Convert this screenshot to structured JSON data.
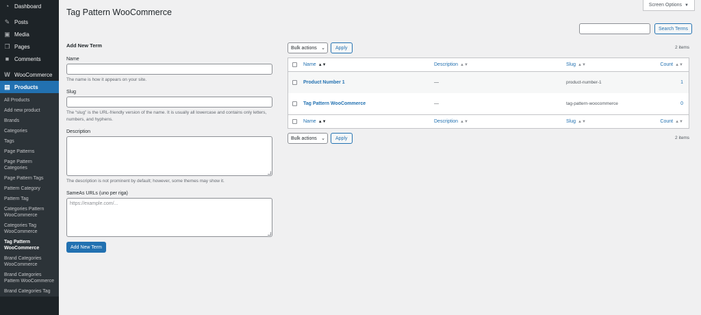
{
  "sidebar": {
    "top_items": [
      {
        "label": "Dashboard",
        "icon": "dashboard-icon"
      },
      {
        "label": "Posts",
        "icon": "pin-icon"
      },
      {
        "label": "Media",
        "icon": "media-icon"
      },
      {
        "label": "Pages",
        "icon": "pages-icon"
      },
      {
        "label": "Comments",
        "icon": "comment-icon"
      },
      {
        "label": "WooCommerce",
        "icon": "woo-icon"
      },
      {
        "label": "Products",
        "icon": "products-icon"
      }
    ],
    "submenu": [
      "All Products",
      "Add new product",
      "Brands",
      "Categories",
      "Tags",
      "Page Patterns",
      "Page Pattern Categories",
      "Page Pattern Tags",
      "Pattern Category",
      "Pattern Tag",
      "Categories Pattern WooCommerce",
      "Categories Tag WooCommerce",
      "Tag Pattern WooCommerce",
      "Brand Categories WooCommerce",
      "Brand Categories Pattern WooCommerce",
      "Brand Categories Tag"
    ],
    "current_sub": "Tag Pattern WooCommerce",
    "accent": "#2271b1"
  },
  "header": {
    "title": "Tag Pattern WooCommerce",
    "screen_options": "Screen Options"
  },
  "search": {
    "button": "Search Terms",
    "value": ""
  },
  "form": {
    "heading": "Add New Term",
    "name_label": "Name",
    "name_help": "The name is how it appears on your site.",
    "slug_label": "Slug",
    "slug_help": "The “slug” is the URL-friendly version of the name. It is usually all lowercase and contains only letters, numbers, and hyphens.",
    "desc_label": "Description",
    "desc_help": "The description is not prominent by default; however, some themes may show it.",
    "sameas_label": "SameAs URLs (uno per riga)",
    "sameas_placeholder": "https://example.com/...",
    "submit": "Add New Term"
  },
  "table": {
    "bulk_label": "Bulk actions",
    "apply_label": "Apply",
    "items_count": "2 items",
    "columns": {
      "name": "Name",
      "description": "Description",
      "slug": "Slug",
      "count": "Count"
    },
    "rows": [
      {
        "name": "Product Number 1",
        "description": "—",
        "slug": "product-number-1",
        "count": "1"
      },
      {
        "name": "Tag Pattern WooCommerce",
        "description": "—",
        "slug": "tag-pattern-woocommerce",
        "count": "0"
      }
    ]
  }
}
